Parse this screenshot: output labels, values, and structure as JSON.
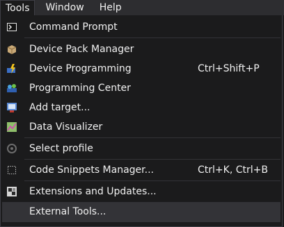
{
  "menubar": {
    "items": [
      {
        "label": "Tools",
        "open": true
      },
      {
        "label": "Window"
      },
      {
        "label": "Help"
      }
    ]
  },
  "menu": {
    "items": [
      {
        "label": "Command Prompt",
        "shortcut": "",
        "icon": "terminal-icon"
      },
      {
        "label": "Device Pack Manager",
        "shortcut": "",
        "icon": "package-icon"
      },
      {
        "label": "Device Programming",
        "shortcut": "Ctrl+Shift+P",
        "icon": "device-programming-icon"
      },
      {
        "label": "Programming Center",
        "shortcut": "",
        "icon": "programming-center-icon"
      },
      {
        "label": "Add target...",
        "shortcut": "",
        "icon": "add-target-icon"
      },
      {
        "label": "Data Visualizer",
        "shortcut": "",
        "icon": "data-visualizer-icon"
      },
      {
        "label": "Select profile",
        "shortcut": "",
        "icon": "select-profile-icon"
      },
      {
        "label": "Code Snippets Manager...",
        "shortcut": "Ctrl+K, Ctrl+B",
        "icon": "code-snippets-icon"
      },
      {
        "label": "Extensions and Updates...",
        "shortcut": "",
        "icon": "extensions-icon"
      },
      {
        "label": "External Tools...",
        "shortcut": "",
        "icon": "",
        "highlighted": true
      }
    ]
  },
  "colors": {
    "menu_background": "#1b1b1c",
    "menubar_background": "#2d2d30",
    "highlight": "#333337",
    "text": "#f1f1f1"
  }
}
